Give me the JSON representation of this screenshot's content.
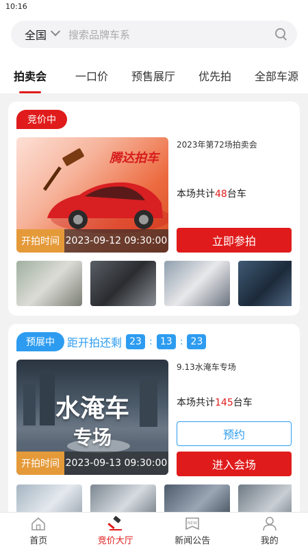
{
  "status_bar": {
    "time": "10:16"
  },
  "search": {
    "region": "全国",
    "placeholder": "搜索品牌车系"
  },
  "tabs": [
    {
      "label": "拍卖会",
      "active": true
    },
    {
      "label": "一口价",
      "active": false
    },
    {
      "label": "预售展厅",
      "active": false
    },
    {
      "label": "优先拍",
      "active": false
    },
    {
      "label": "全部车源",
      "active": false
    }
  ],
  "auctions": [
    {
      "status": "竞价中",
      "cover_brand": "腾达拍车",
      "start_label": "开拍时间",
      "start_time": "2023-09-12 09:30:00",
      "title": "2023年第72场拍卖会",
      "count_prefix": "本场共计",
      "count": "48",
      "count_suffix": "台车",
      "primary_button": "立即参拍"
    },
    {
      "status": "预展中",
      "countdown_label": "距开拍还剩",
      "countdown": {
        "hours": "23",
        "minutes": "13",
        "seconds": "23"
      },
      "cover_line1": "水淹车",
      "cover_line2": "专场",
      "start_label": "开拍时间",
      "start_time": "2023-09-13 09:30:00",
      "title": "9.13水淹车专场",
      "count_prefix": "本场共计",
      "count": "145",
      "count_suffix": "台车",
      "secondary_button": "预约",
      "primary_button": "进入会场"
    }
  ],
  "bottom_nav": [
    {
      "label": "首页",
      "icon": "home-icon",
      "active": false
    },
    {
      "label": "竞价大厅",
      "icon": "gavel-icon",
      "active": true
    },
    {
      "label": "新闻公告",
      "icon": "news-icon",
      "active": false
    },
    {
      "label": "我的",
      "icon": "user-icon",
      "active": false
    }
  ],
  "colors": {
    "accent": "#e01b1b",
    "preview": "#2d9cf0",
    "time_label": "#e59a3a"
  }
}
